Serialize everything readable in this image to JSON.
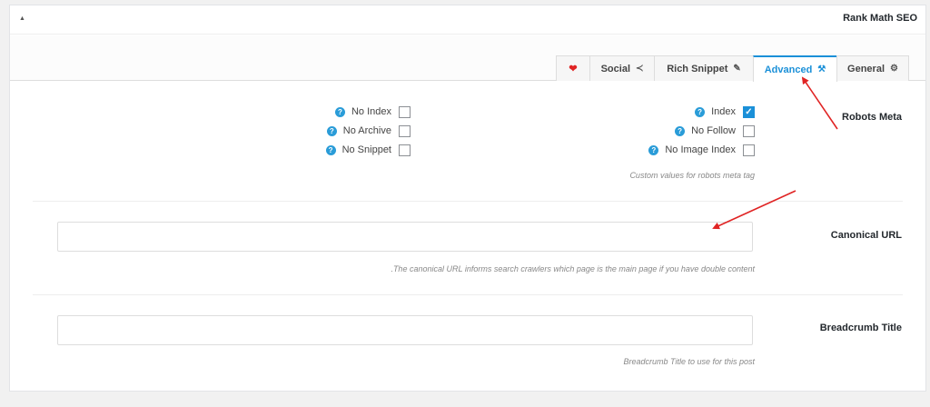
{
  "panel": {
    "title": "Rank Math SEO",
    "collapse_icon": "triangle-up-icon"
  },
  "tabs": [
    {
      "id": "heart",
      "label": "",
      "icon": "heart-icon",
      "glyph": "❤"
    },
    {
      "id": "social",
      "label": "Social",
      "icon": "share-icon",
      "glyph": "≺"
    },
    {
      "id": "rich-snippet",
      "label": "Rich Snippet",
      "icon": "pin-icon",
      "glyph": "✎"
    },
    {
      "id": "advanced",
      "label": "Advanced",
      "icon": "wrench-icon",
      "glyph": "⚒",
      "active": true
    },
    {
      "id": "general",
      "label": "General",
      "icon": "gear-icon",
      "glyph": "⚙"
    }
  ],
  "robots": {
    "label": "Robots Meta",
    "left": [
      {
        "label": "No Index",
        "checked": false
      },
      {
        "label": "No Archive",
        "checked": false
      },
      {
        "label": "No Snippet",
        "checked": false
      }
    ],
    "right": [
      {
        "label": "Index",
        "checked": true
      },
      {
        "label": "No Follow",
        "checked": false
      },
      {
        "label": "No Image Index",
        "checked": false
      }
    ],
    "description": "Custom values for robots meta tag"
  },
  "canonical": {
    "label": "Canonical URL",
    "value": "",
    "description": ".The canonical URL informs search crawlers which page is the main page if you have double content"
  },
  "breadcrumb": {
    "label": "Breadcrumb Title",
    "value": "",
    "description": "Breadcrumb Title to use for this post"
  },
  "colors": {
    "accent": "#1b90d8",
    "help": "#2a9cd8",
    "annotation_arrow": "#e02424"
  }
}
